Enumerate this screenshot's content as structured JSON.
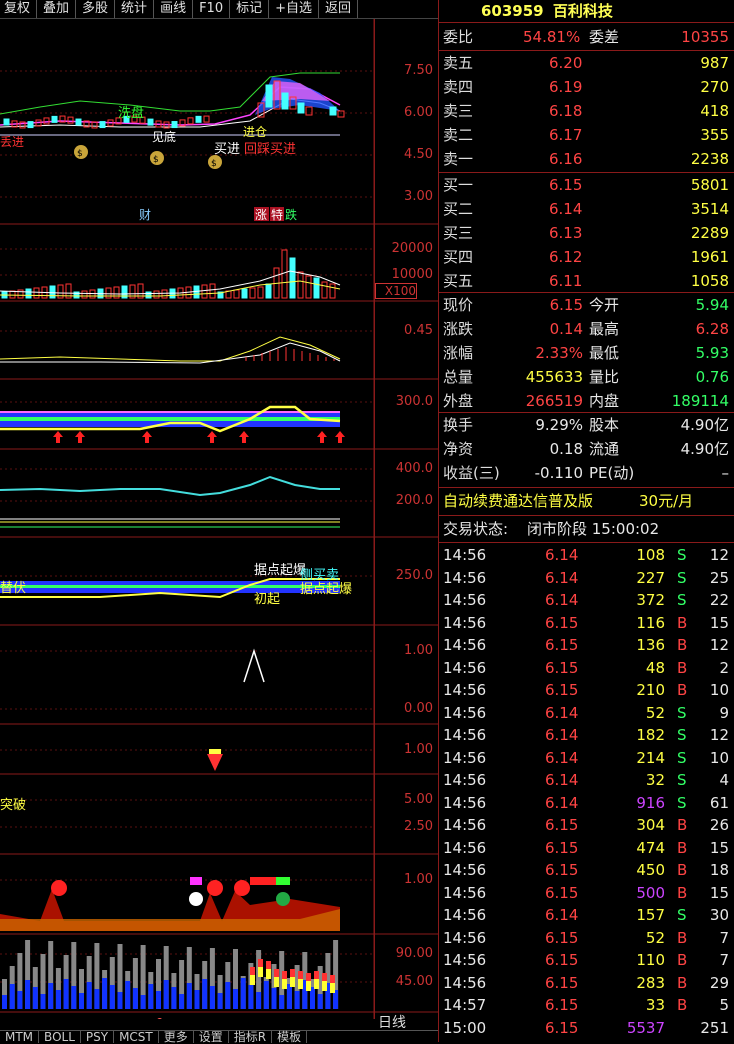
{
  "toolbar": [
    "复权",
    "叠加",
    "多股",
    "统计",
    "画线",
    "F10",
    "标记",
    "+自选",
    "返回"
  ],
  "stock": {
    "code": "603959",
    "name": "百利科技"
  },
  "weibi": {
    "label": "委比",
    "value": "54.81%",
    "label2": "委差",
    "value2": "10355"
  },
  "asks": [
    {
      "label": "卖五",
      "price": "6.20",
      "vol": "987"
    },
    {
      "label": "卖四",
      "price": "6.19",
      "vol": "270"
    },
    {
      "label": "卖三",
      "price": "6.18",
      "vol": "418"
    },
    {
      "label": "卖二",
      "price": "6.17",
      "vol": "355"
    },
    {
      "label": "卖一",
      "price": "6.16",
      "vol": "2238"
    }
  ],
  "bids": [
    {
      "label": "买一",
      "price": "6.15",
      "vol": "5801"
    },
    {
      "label": "买二",
      "price": "6.14",
      "vol": "3514"
    },
    {
      "label": "买三",
      "price": "6.13",
      "vol": "2289"
    },
    {
      "label": "买四",
      "price": "6.12",
      "vol": "1961"
    },
    {
      "label": "买五",
      "price": "6.11",
      "vol": "1058"
    }
  ],
  "quote": [
    {
      "l1": "现价",
      "v1": "6.15",
      "c1": "red",
      "l2": "今开",
      "v2": "5.94",
      "c2": "green"
    },
    {
      "l1": "涨跌",
      "v1": "0.14",
      "c1": "red",
      "l2": "最高",
      "v2": "6.28",
      "c2": "red"
    },
    {
      "l1": "涨幅",
      "v1": "2.33%",
      "c1": "red",
      "l2": "最低",
      "v2": "5.93",
      "c2": "green"
    },
    {
      "l1": "总量",
      "v1": "455633",
      "c1": "yellow",
      "l2": "量比",
      "v2": "0.76",
      "c2": "green"
    },
    {
      "l1": "外盘",
      "v1": "266519",
      "c1": "red",
      "l2": "内盘",
      "v2": "189114",
      "c2": "green"
    }
  ],
  "fundamentals": [
    {
      "l1": "换手",
      "v1": "9.29%",
      "l2": "股本",
      "v2": "4.90亿"
    },
    {
      "l1": "净资",
      "v1": "0.18",
      "l2": "流通",
      "v2": "4.90亿"
    },
    {
      "l1": "收益(三)",
      "v1": "-0.110",
      "l2": "PE(动)",
      "v2": "–"
    }
  ],
  "promo": {
    "text": "自动续费通达信普及版",
    "price": "30元/月"
  },
  "trade_status": {
    "label": "交易状态:",
    "value": "闭市阶段 15:00:02"
  },
  "ticks": [
    {
      "t": "14:56",
      "p": "6.14",
      "v": "108",
      "s": "S",
      "n": "12"
    },
    {
      "t": "14:56",
      "p": "6.14",
      "v": "227",
      "s": "S",
      "n": "25"
    },
    {
      "t": "14:56",
      "p": "6.14",
      "v": "372",
      "s": "S",
      "n": "22"
    },
    {
      "t": "14:56",
      "p": "6.15",
      "v": "116",
      "s": "B",
      "n": "15"
    },
    {
      "t": "14:56",
      "p": "6.15",
      "v": "136",
      "s": "B",
      "n": "12"
    },
    {
      "t": "14:56",
      "p": "6.15",
      "v": "48",
      "s": "B",
      "n": "2"
    },
    {
      "t": "14:56",
      "p": "6.15",
      "v": "210",
      "s": "B",
      "n": "10"
    },
    {
      "t": "14:56",
      "p": "6.14",
      "v": "52",
      "s": "S",
      "n": "9"
    },
    {
      "t": "14:56",
      "p": "6.14",
      "v": "182",
      "s": "S",
      "n": "12"
    },
    {
      "t": "14:56",
      "p": "6.14",
      "v": "214",
      "s": "S",
      "n": "10"
    },
    {
      "t": "14:56",
      "p": "6.14",
      "v": "32",
      "s": "S",
      "n": "4"
    },
    {
      "t": "14:56",
      "p": "6.14",
      "v": "916",
      "s": "S",
      "n": "61"
    },
    {
      "t": "14:56",
      "p": "6.15",
      "v": "304",
      "s": "B",
      "n": "26"
    },
    {
      "t": "14:56",
      "p": "6.15",
      "v": "474",
      "s": "B",
      "n": "15"
    },
    {
      "t": "14:56",
      "p": "6.15",
      "v": "450",
      "s": "B",
      "n": "18"
    },
    {
      "t": "14:56",
      "p": "6.15",
      "v": "500",
      "s": "B",
      "n": "15"
    },
    {
      "t": "14:56",
      "p": "6.14",
      "v": "157",
      "s": "S",
      "n": "30"
    },
    {
      "t": "14:56",
      "p": "6.15",
      "v": "52",
      "s": "B",
      "n": "7"
    },
    {
      "t": "14:56",
      "p": "6.15",
      "v": "110",
      "s": "B",
      "n": "7"
    },
    {
      "t": "14:56",
      "p": "6.15",
      "v": "283",
      "s": "B",
      "n": "29"
    },
    {
      "t": "14:57",
      "p": "6.15",
      "v": "33",
      "s": "B",
      "n": "5"
    },
    {
      "t": "15:00",
      "p": "6.15",
      "v": "5537",
      "s": "",
      "n": "251"
    }
  ],
  "axis_labels": [
    "7.50",
    "6.00",
    "4.50",
    "3.00",
    "20000",
    "10000",
    "X100",
    "0.45",
    "300.0",
    "400.0",
    "200.0",
    "250.0",
    "1.00",
    "0.00",
    "1.00",
    "5.00",
    "2.50",
    "1.00",
    "90.00",
    "45.00"
  ],
  "chart_text": {
    "xipan": "洗盘",
    "dibu": "见底",
    "jincang": "进仓",
    "maijin": "买进",
    "huicai": "回踩买进",
    "gai": "丢进",
    "cai": "财",
    "zhang": "涨",
    "die": "跌",
    "te": "特",
    "ju": "据点起爆",
    "cemai": "侧买卖",
    "fu": "替伏",
    "chu": "初起",
    "qibao": "据点起爆",
    "tupo": "突破",
    "xspot": "9",
    "dayline": "日线"
  },
  "bottom_tabs": [
    "MTM",
    "BOLL",
    "PSY",
    "MCST",
    "更多",
    "设置",
    "指标R",
    "模板"
  ],
  "colors": {
    "accent_red": "#ff4444",
    "green": "#33ff66",
    "yellow": "#ffff44",
    "axis": "#cc3333"
  }
}
